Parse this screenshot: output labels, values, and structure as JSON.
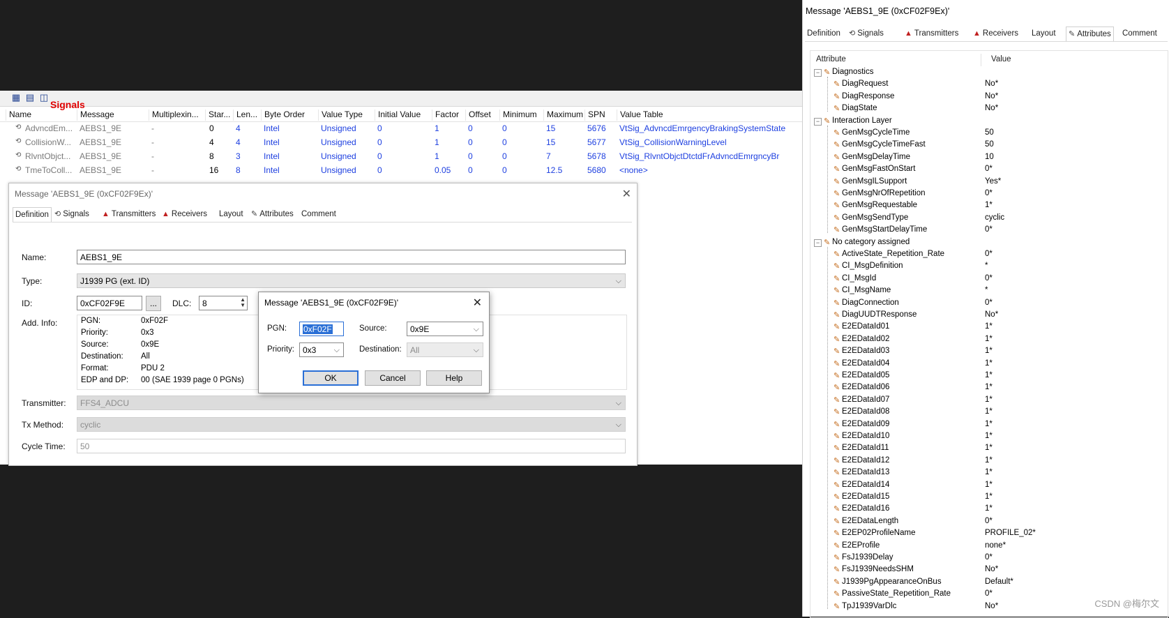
{
  "signals_panel": {
    "title": "Signals",
    "columns": [
      "Name",
      "Message",
      "Multiplexin...",
      "Star...",
      "Len...",
      "Byte Order",
      "Value Type",
      "Initial Value",
      "Factor",
      "Offset",
      "Minimum",
      "Maximum",
      "SPN",
      "Value Table"
    ],
    "rows": [
      {
        "name": "AdvncdEm...",
        "message": "AEBS1_9E",
        "mux": "-",
        "start": "0",
        "len": "4",
        "byte_order": "Intel",
        "value_type": "Unsigned",
        "initial": "0",
        "factor": "1",
        "offset": "0",
        "minimum": "0",
        "maximum": "15",
        "spn": "5676",
        "value_table": "VtSig_AdvncdEmrgencyBrakingSystemState"
      },
      {
        "name": "CollisionW...",
        "message": "AEBS1_9E",
        "mux": "-",
        "start": "4",
        "len": "4",
        "byte_order": "Intel",
        "value_type": "Unsigned",
        "initial": "0",
        "factor": "1",
        "offset": "0",
        "minimum": "0",
        "maximum": "15",
        "spn": "5677",
        "value_table": "VtSig_CollisionWarningLevel"
      },
      {
        "name": "RlvntObjct...",
        "message": "AEBS1_9E",
        "mux": "-",
        "start": "8",
        "len": "3",
        "byte_order": "Intel",
        "value_type": "Unsigned",
        "initial": "0",
        "factor": "1",
        "offset": "0",
        "minimum": "0",
        "maximum": "7",
        "spn": "5678",
        "value_table": "VtSig_RlvntObjctDtctdFrAdvncdEmrgncyBr"
      },
      {
        "name": "TmeToColl...",
        "message": "AEBS1_9E",
        "mux": "-",
        "start": "16",
        "len": "8",
        "byte_order": "Intel",
        "value_type": "Unsigned",
        "initial": "0",
        "factor": "0.05",
        "offset": "0",
        "minimum": "0",
        "maximum": "12.5",
        "spn": "5680",
        "value_table": "<none>"
      }
    ]
  },
  "message_dialog": {
    "title": "Message 'AEBS1_9E (0xCF02F9Ex)'",
    "tabs": [
      "Definition",
      "Signals",
      "Transmitters",
      "Receivers",
      "Layout",
      "Attributes",
      "Comment"
    ],
    "name_label": "Name:",
    "name_value": "AEBS1_9E",
    "type_label": "Type:",
    "type_value": "J1939 PG (ext. ID)",
    "id_label": "ID:",
    "id_value": "0xCF02F9E",
    "id_button": "...",
    "dlc_label": "DLC:",
    "dlc_value": "8",
    "addinfo_label": "Add. Info:",
    "addinfo": [
      {
        "k": "PGN:",
        "v": "0xF02F"
      },
      {
        "k": "Priority:",
        "v": "0x3"
      },
      {
        "k": "Source:",
        "v": "0x9E"
      },
      {
        "k": "Destination:",
        "v": "All"
      },
      {
        "k": "Format:",
        "v": "PDU 2"
      },
      {
        "k": "EDP and DP:",
        "v": "00 (SAE 1939 page 0 PGNs)"
      }
    ],
    "transmitter_label": "Transmitter:",
    "transmitter_value": "FFS4_ADCU",
    "txmethod_label": "Tx Method:",
    "txmethod_value": "cyclic",
    "cycletime_label": "Cycle Time:",
    "cycletime_value": "50"
  },
  "pgn_dialog": {
    "title": "Message 'AEBS1_9E (0xCF02F9E)'",
    "pgn_label": "PGN:",
    "pgn_value": "0xF02F",
    "source_label": "Source:",
    "source_value": "0x9E",
    "priority_label": "Priority:",
    "priority_value": "0x3",
    "destination_label": "Destination:",
    "destination_value": "All",
    "ok": "OK",
    "cancel": "Cancel",
    "help": "Help"
  },
  "attr_panel": {
    "title": "Message 'AEBS1_9E (0xCF02F9Ex)'",
    "tabs": [
      "Definition",
      "Signals",
      "Transmitters",
      "Receivers",
      "Layout",
      "Attributes",
      "Comment"
    ],
    "col_attribute": "Attribute",
    "col_value": "Value",
    "groups": [
      {
        "name": "Diagnostics",
        "items": [
          {
            "n": "DiagRequest",
            "v": "No*"
          },
          {
            "n": "DiagResponse",
            "v": "No*"
          },
          {
            "n": "DiagState",
            "v": "No*"
          }
        ]
      },
      {
        "name": "Interaction Layer",
        "items": [
          {
            "n": "GenMsgCycleTime",
            "v": "50"
          },
          {
            "n": "GenMsgCycleTimeFast",
            "v": "50"
          },
          {
            "n": "GenMsgDelayTime",
            "v": "10"
          },
          {
            "n": "GenMsgFastOnStart",
            "v": "0*"
          },
          {
            "n": "GenMsgILSupport",
            "v": "Yes*"
          },
          {
            "n": "GenMsgNrOfRepetition",
            "v": "0*"
          },
          {
            "n": "GenMsgRequestable",
            "v": "1*"
          },
          {
            "n": "GenMsgSendType",
            "v": "cyclic"
          },
          {
            "n": "GenMsgStartDelayTime",
            "v": "0*"
          }
        ]
      },
      {
        "name": "No category assigned",
        "items": [
          {
            "n": "ActiveState_Repetition_Rate",
            "v": "0*"
          },
          {
            "n": "CI_MsgDefinition",
            "v": "*"
          },
          {
            "n": "CI_MsgId",
            "v": "0*"
          },
          {
            "n": "CI_MsgName",
            "v": "*"
          },
          {
            "n": "DiagConnection",
            "v": "0*"
          },
          {
            "n": "DiagUUDTResponse",
            "v": "No*"
          },
          {
            "n": "E2EDataId01",
            "v": "1*"
          },
          {
            "n": "E2EDataId02",
            "v": "1*"
          },
          {
            "n": "E2EDataId03",
            "v": "1*"
          },
          {
            "n": "E2EDataId04",
            "v": "1*"
          },
          {
            "n": "E2EDataId05",
            "v": "1*"
          },
          {
            "n": "E2EDataId06",
            "v": "1*"
          },
          {
            "n": "E2EDataId07",
            "v": "1*"
          },
          {
            "n": "E2EDataId08",
            "v": "1*"
          },
          {
            "n": "E2EDataId09",
            "v": "1*"
          },
          {
            "n": "E2EDataId10",
            "v": "1*"
          },
          {
            "n": "E2EDataId11",
            "v": "1*"
          },
          {
            "n": "E2EDataId12",
            "v": "1*"
          },
          {
            "n": "E2EDataId13",
            "v": "1*"
          },
          {
            "n": "E2EDataId14",
            "v": "1*"
          },
          {
            "n": "E2EDataId15",
            "v": "1*"
          },
          {
            "n": "E2EDataId16",
            "v": "1*"
          },
          {
            "n": "E2EDataLength",
            "v": "0*"
          },
          {
            "n": "E2EP02ProfileName",
            "v": "PROFILE_02*"
          },
          {
            "n": "E2EProfile",
            "v": "none*"
          },
          {
            "n": "FsJ1939Delay",
            "v": "0*"
          },
          {
            "n": "FsJ1939NeedsSHM",
            "v": "No*"
          },
          {
            "n": "J1939PgAppearanceOnBus",
            "v": "Default*"
          },
          {
            "n": "PassiveState_Repetition_Rate",
            "v": "0*"
          },
          {
            "n": "TpJ1939VarDlc",
            "v": "No*"
          }
        ]
      }
    ]
  },
  "watermark": "CSDN @梅尔文"
}
